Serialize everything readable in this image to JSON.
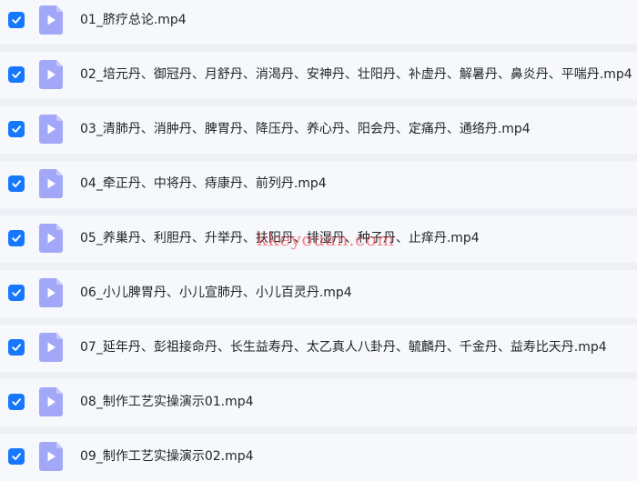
{
  "colors": {
    "checkbox": "#1677ff",
    "file_icon": "#a3a7f7",
    "row_background": "#f7f8fc",
    "separator": "#eef0f6",
    "watermark": "#eb2828"
  },
  "icons": {
    "checkbox": "check-icon",
    "file": "video-file-icon"
  },
  "files": [
    {
      "name": "01_脐疗总论.mp4",
      "checked": true
    },
    {
      "name": "02_培元丹、御冠丹、月舒丹、消渴丹、安神丹、壮阳丹、补虚丹、解暑丹、鼻炎丹、平喘丹.mp4",
      "checked": true
    },
    {
      "name": "03_清肺丹、消肿丹、脾胃丹、降压丹、养心丹、阳会丹、定痛丹、通络丹.mp4",
      "checked": true
    },
    {
      "name": "04_牵正丹、中将丹、痔康丹、前列丹.mp4",
      "checked": true
    },
    {
      "name": "05_养巢丹、利胆丹、升举丹、扶阳丹、排湿丹、种子丹、止痒丹.mp4",
      "checked": true
    },
    {
      "name": "06_小儿脾胃丹、小儿宣肺丹、小儿百灵丹.mp4",
      "checked": true
    },
    {
      "name": "07_延年丹、彭祖接命丹、长生益寿丹、太乙真人八卦丹、毓麟丹、千金丹、益寿比天丹.mp4",
      "checked": true
    },
    {
      "name": "08_制作工艺实操演示01.mp4",
      "checked": true
    },
    {
      "name": "09_制作工艺实操演示02.mp4",
      "checked": true
    }
  ],
  "watermark": {
    "text": "kkeyouan.com"
  }
}
